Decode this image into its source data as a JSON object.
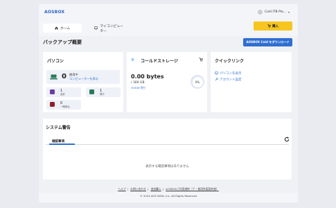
{
  "header": {
    "logo": "AOSBOX",
    "user_name": "Cold ITB Pla...",
    "caret": "▾"
  },
  "nav": {
    "tabs": [
      {
        "label": "ホーム",
        "active": true
      },
      {
        "label": "マイコンピューター",
        "active": false
      }
    ]
  },
  "buy": {
    "label": "購入"
  },
  "page": {
    "title": "バックアップ概要",
    "download_label": "AOSBOX Cold をダウンロード"
  },
  "pc_card": {
    "title": "パソコン",
    "count": "0",
    "status": "使用中",
    "link": "コンピューターを表示",
    "total": {
      "num": "1",
      "label": "合計"
    },
    "remaining": {
      "num": "1",
      "label": "残り"
    },
    "paused": {
      "num": "0",
      "label": "一時停止"
    }
  },
  "cold_card": {
    "title": "コールドストレージ",
    "bytes": "0.00 bytes",
    "quota": "/ 300 GB",
    "remaining": "300GB 残り",
    "percent": "0%",
    "fraction": 0
  },
  "quick_card": {
    "title": "クイックリンク",
    "links": [
      "パソコンを表示",
      "アカウント設定"
    ]
  },
  "warnings": {
    "title": "システム警告",
    "tab": "確認事項",
    "empty": "表示する確認事項はありません"
  },
  "footer": {
    "links": [
      "ヘルプ",
      "お問い合わせ",
      "追加購入",
      "AOSBOXご利用規約（个・使用許諾契約書）"
    ],
    "copyright": "© 2024 AOS DATA, Inc. All Rights Reserved"
  },
  "colors": {
    "accent": "#2f6fd1",
    "buy": "#f6c51f"
  }
}
